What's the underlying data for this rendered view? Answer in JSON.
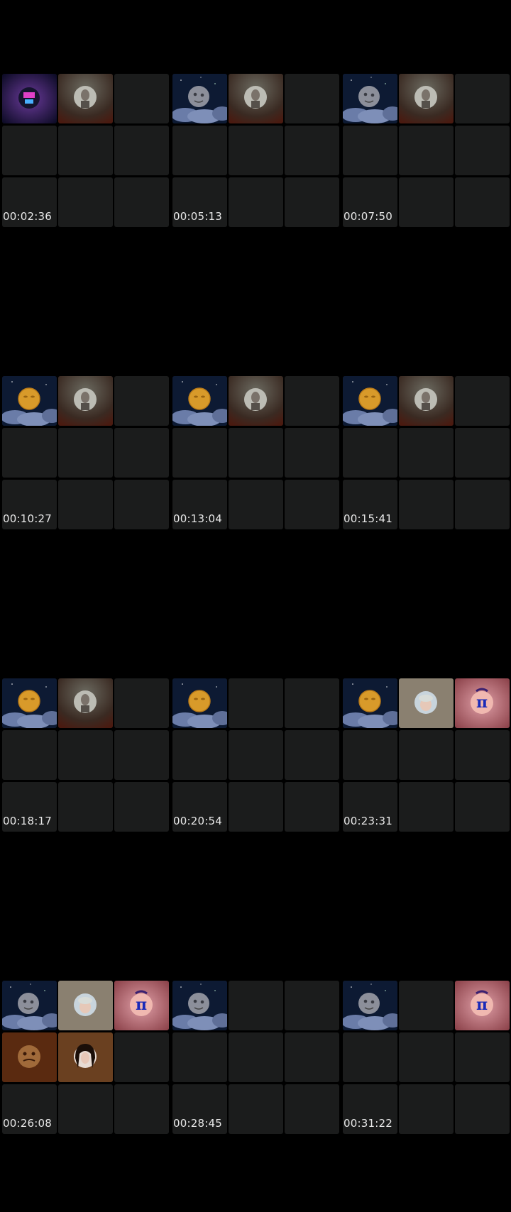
{
  "thumbnails": [
    {
      "timestamp": "00:02:36",
      "tiles": [
        "avatar-neon",
        "avatar-gray-person",
        "empty",
        "empty",
        "empty",
        "empty",
        "empty",
        "empty",
        "empty"
      ]
    },
    {
      "timestamp": "00:05:13",
      "tiles": [
        "moon-gray-clouds",
        "avatar-gray-person",
        "empty",
        "empty",
        "empty",
        "empty",
        "empty",
        "empty",
        "empty"
      ]
    },
    {
      "timestamp": "00:07:50",
      "tiles": [
        "moon-gray-clouds",
        "avatar-gray-person",
        "empty",
        "empty",
        "empty",
        "empty",
        "empty",
        "empty",
        "empty"
      ]
    },
    {
      "timestamp": "00:10:27",
      "tiles": [
        "moon-gold-clouds",
        "avatar-gray-person",
        "empty",
        "empty",
        "empty",
        "empty",
        "empty",
        "empty",
        "empty"
      ]
    },
    {
      "timestamp": "00:13:04",
      "tiles": [
        "moon-gold-clouds",
        "avatar-gray-person",
        "empty",
        "empty",
        "empty",
        "empty",
        "empty",
        "empty",
        "empty"
      ]
    },
    {
      "timestamp": "00:15:41",
      "tiles": [
        "moon-gold-clouds",
        "avatar-gray-person",
        "empty",
        "empty",
        "empty",
        "empty",
        "empty",
        "empty",
        "empty"
      ]
    },
    {
      "timestamp": "00:18:17",
      "tiles": [
        "moon-gold-clouds",
        "avatar-gray-person",
        "empty",
        "empty",
        "empty",
        "empty",
        "empty",
        "empty",
        "empty"
      ]
    },
    {
      "timestamp": "00:20:54",
      "tiles": [
        "moon-gold-clouds",
        "empty",
        "empty",
        "empty",
        "empty",
        "empty",
        "empty",
        "empty",
        "empty"
      ]
    },
    {
      "timestamp": "00:23:31",
      "tiles": [
        "moon-gold-clouds",
        "avatar-older-person",
        "avatar-pi",
        "empty",
        "empty",
        "empty",
        "empty",
        "empty",
        "empty"
      ]
    },
    {
      "timestamp": "00:26:08",
      "tiles": [
        "moon-gray-clouds",
        "avatar-older-person",
        "avatar-pi",
        "avatar-brown-face",
        "avatar-dark-hair",
        "empty",
        "empty",
        "empty",
        "empty"
      ]
    },
    {
      "timestamp": "00:28:45",
      "tiles": [
        "moon-gray-clouds",
        "empty",
        "empty",
        "empty",
        "empty",
        "empty",
        "empty",
        "empty",
        "empty"
      ]
    },
    {
      "timestamp": "00:31:22",
      "tiles": [
        "moon-gray-clouds",
        "empty",
        "avatar-pi",
        "empty",
        "empty",
        "empty",
        "empty",
        "empty",
        "empty"
      ]
    }
  ],
  "pi_symbol": "π"
}
